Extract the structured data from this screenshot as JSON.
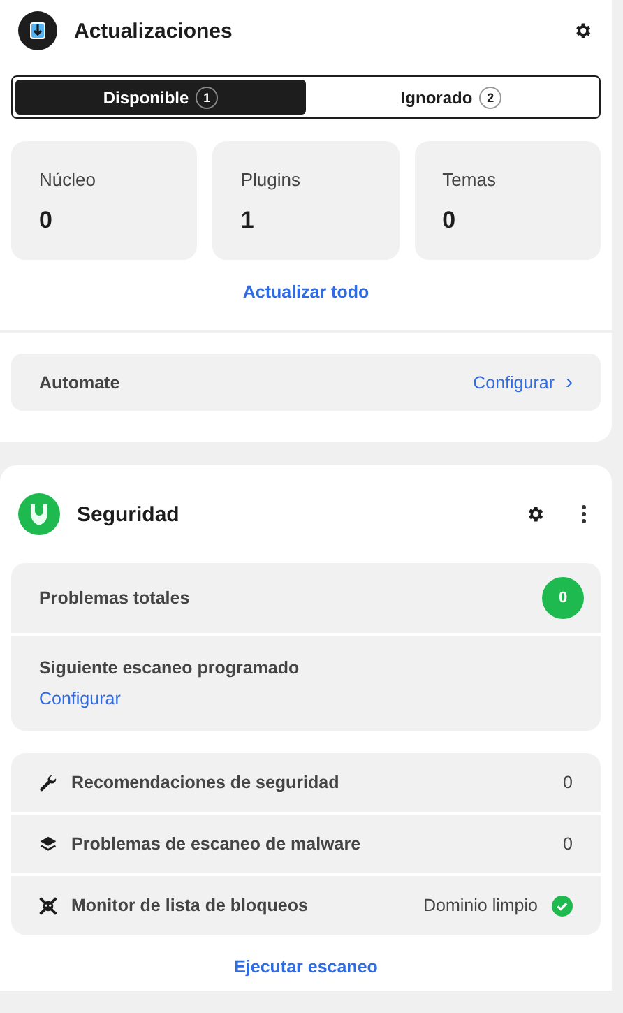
{
  "updates": {
    "title": "Actualizaciones",
    "tabs": [
      {
        "label": "Disponible",
        "count": "1",
        "selected": true
      },
      {
        "label": "Ignorado",
        "count": "2",
        "selected": false
      }
    ],
    "stats": [
      {
        "label": "Núcleo",
        "value": "0"
      },
      {
        "label": "Plugins",
        "value": "1"
      },
      {
        "label": "Temas",
        "value": "0"
      }
    ],
    "update_all": "Actualizar todo"
  },
  "automate": {
    "label": "Automate",
    "action": "Configurar",
    "action_icon": "›"
  },
  "security": {
    "title": "Seguridad",
    "total": {
      "label": "Problemas totales",
      "count": "0"
    },
    "next_scan": {
      "label": "Siguiente escaneo programado",
      "link": "Configurar"
    },
    "items": [
      {
        "kind": "wrench",
        "label": "Recomendaciones de seguridad",
        "value": "0",
        "clean": false
      },
      {
        "kind": "layers",
        "label": "Problemas de escaneo de malware",
        "value": "0",
        "clean": false
      },
      {
        "kind": "skull",
        "label": "Monitor de lista de bloqueos",
        "value": "Dominio limpio",
        "clean": true
      }
    ],
    "run_scan": "Ejecutar escaneo"
  }
}
